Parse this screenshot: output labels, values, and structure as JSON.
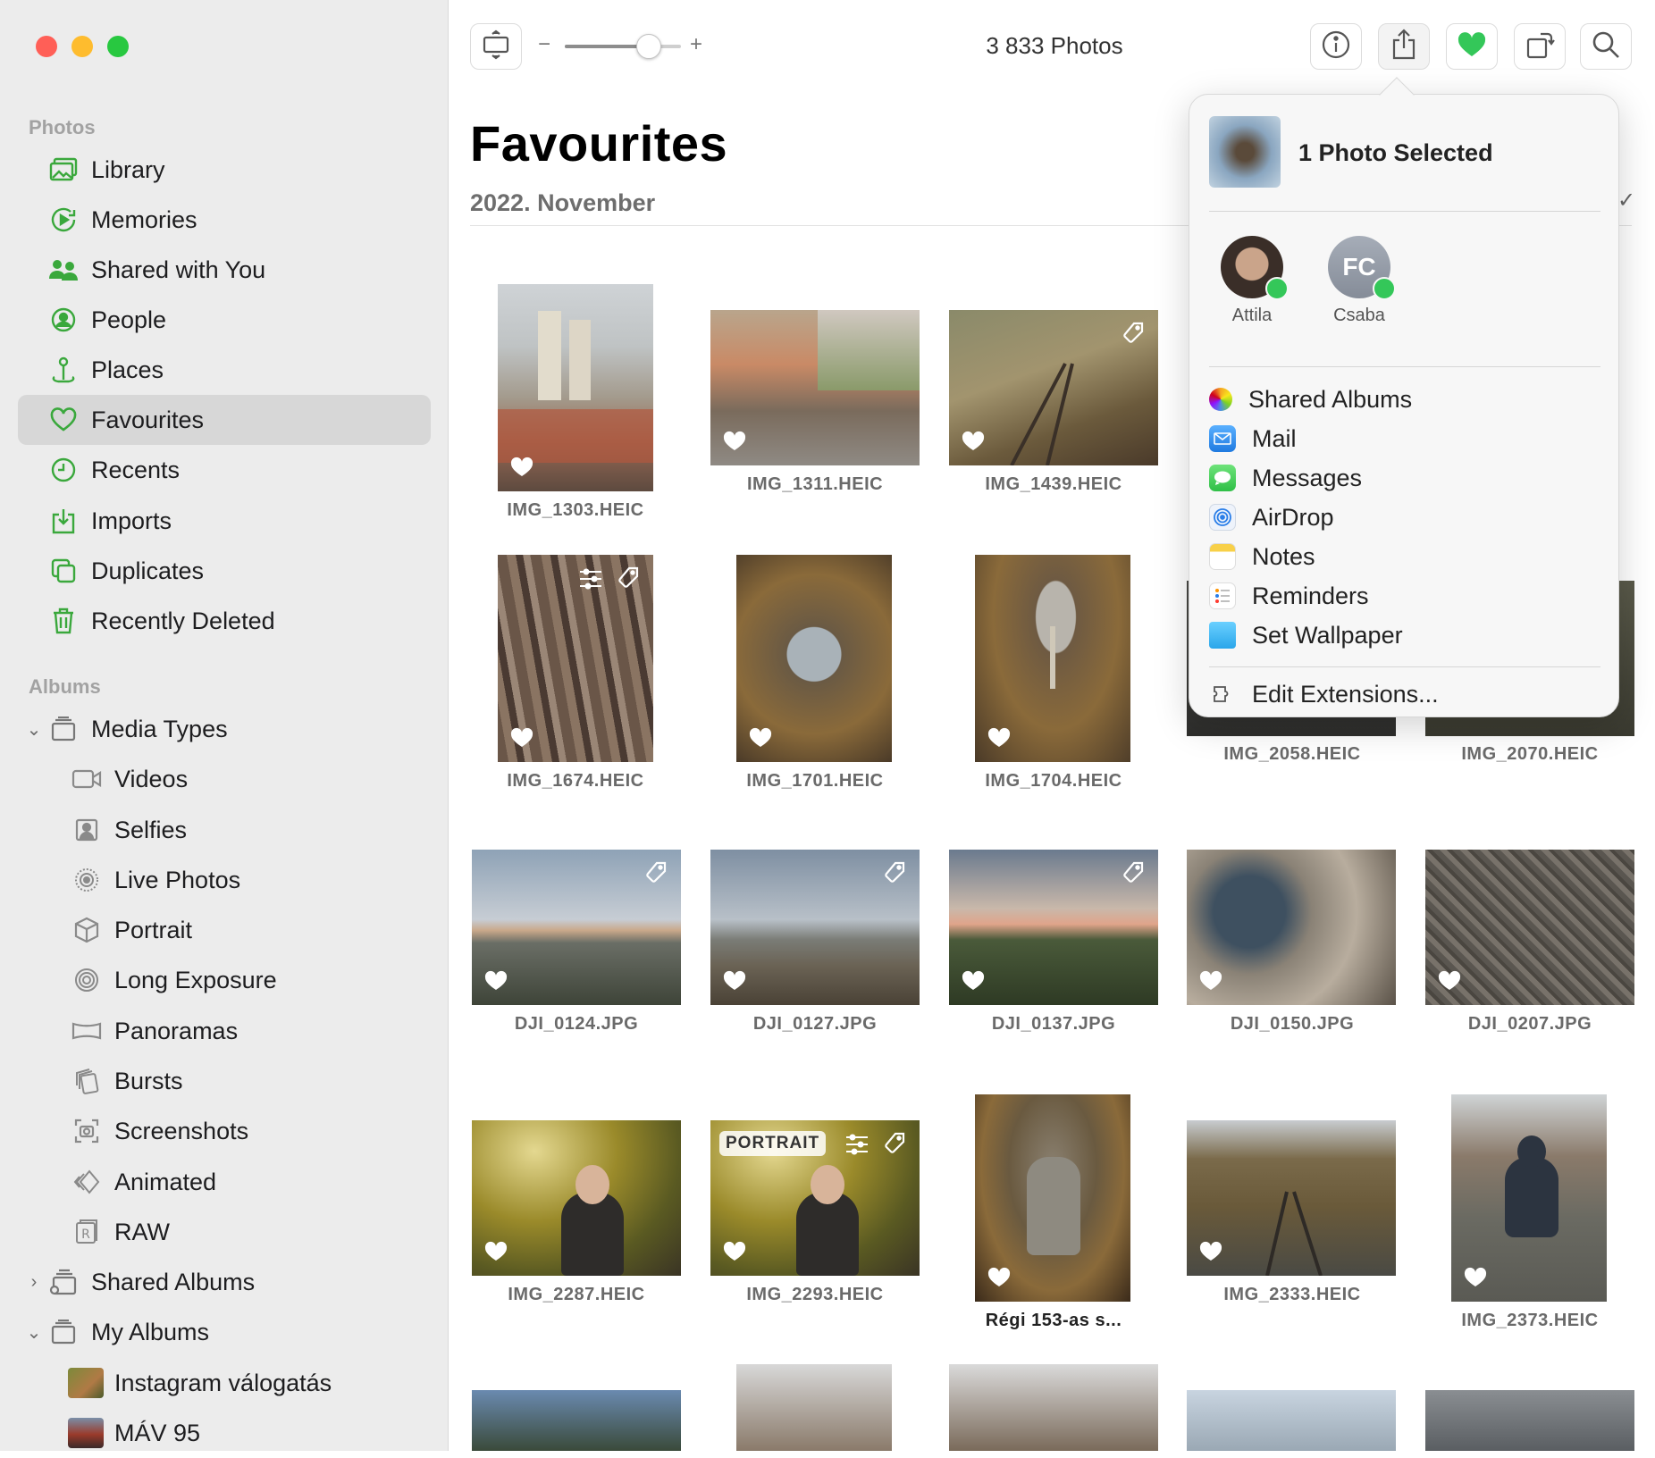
{
  "window": {
    "traffic_lights": {
      "close": "#ff5f57",
      "minimize": "#febc2e",
      "zoom": "#28c840"
    }
  },
  "sidebar": {
    "photos_header": "Photos",
    "photos_items": [
      {
        "label": "Library",
        "icon": "photo-library-icon"
      },
      {
        "label": "Memories",
        "icon": "memories-icon"
      },
      {
        "label": "Shared with You",
        "icon": "shared-with-you-icon"
      },
      {
        "label": "People",
        "icon": "people-icon"
      },
      {
        "label": "Places",
        "icon": "places-icon"
      },
      {
        "label": "Favourites",
        "icon": "heart-icon",
        "selected": true
      },
      {
        "label": "Recents",
        "icon": "clock-icon"
      },
      {
        "label": "Imports",
        "icon": "import-icon"
      },
      {
        "label": "Duplicates",
        "icon": "duplicates-icon"
      },
      {
        "label": "Recently Deleted",
        "icon": "trash-icon"
      }
    ],
    "albums_header": "Albums",
    "media_types": {
      "label": "Media Types",
      "expanded": true
    },
    "media_items": [
      {
        "label": "Videos",
        "icon": "video-icon"
      },
      {
        "label": "Selfies",
        "icon": "selfie-icon"
      },
      {
        "label": "Live Photos",
        "icon": "live-photo-icon"
      },
      {
        "label": "Portrait",
        "icon": "portrait-cube-icon"
      },
      {
        "label": "Long Exposure",
        "icon": "long-exposure-icon"
      },
      {
        "label": "Panoramas",
        "icon": "panorama-icon"
      },
      {
        "label": "Bursts",
        "icon": "bursts-icon"
      },
      {
        "label": "Screenshots",
        "icon": "screenshot-icon"
      },
      {
        "label": "Animated",
        "icon": "animated-icon"
      },
      {
        "label": "RAW",
        "icon": "raw-icon"
      }
    ],
    "shared_albums": {
      "label": "Shared Albums",
      "expanded": false
    },
    "my_albums": {
      "label": "My Albums",
      "expanded": true
    },
    "album_items": [
      {
        "label": "Instagram válogatás"
      },
      {
        "label": "MÁV 95"
      }
    ]
  },
  "toolbar": {
    "photo_count": "3 833 Photos",
    "zoom_minus": "−",
    "zoom_plus": "+",
    "zoom_level": 0.72
  },
  "content": {
    "title": "Favourites",
    "date": "2022. November",
    "photos": [
      {
        "name": "IMG_1303.HEIC"
      },
      {
        "name": "IMG_1311.HEIC"
      },
      {
        "name": "IMG_1439.HEIC"
      },
      {
        "name": "IMG_1674.HEIC"
      },
      {
        "name": "IMG_1701.HEIC"
      },
      {
        "name": "IMG_1704.HEIC"
      },
      {
        "name": "IMG_2058.HEIC"
      },
      {
        "name": "IMG_2070.HEIC"
      },
      {
        "name": "DJI_0124.JPG"
      },
      {
        "name": "DJI_0127.JPG"
      },
      {
        "name": "DJI_0137.JPG"
      },
      {
        "name": "DJI_0150.JPG"
      },
      {
        "name": "DJI_0207.JPG"
      },
      {
        "name": "IMG_2287.HEIC"
      },
      {
        "name": "IMG_2293.HEIC",
        "badge": "PORTRAIT"
      },
      {
        "name": "Régi 153-as s..."
      },
      {
        "name": "IMG_2333.HEIC"
      },
      {
        "name": "IMG_2373.HEIC"
      }
    ]
  },
  "share_popover": {
    "title": "1 Photo Selected",
    "contacts": [
      {
        "name": "Attila"
      },
      {
        "name": "Csaba",
        "initials": "FC"
      }
    ],
    "items": [
      {
        "label": "Shared Albums",
        "icon": "photos-app-icon"
      },
      {
        "label": "Mail",
        "icon": "mail-icon"
      },
      {
        "label": "Messages",
        "icon": "messages-icon"
      },
      {
        "label": "AirDrop",
        "icon": "airdrop-icon"
      },
      {
        "label": "Notes",
        "icon": "notes-icon"
      },
      {
        "label": "Reminders",
        "icon": "reminders-icon"
      },
      {
        "label": "Set Wallpaper",
        "icon": "wallpaper-icon"
      }
    ],
    "edit_extensions": "Edit Extensions..."
  }
}
